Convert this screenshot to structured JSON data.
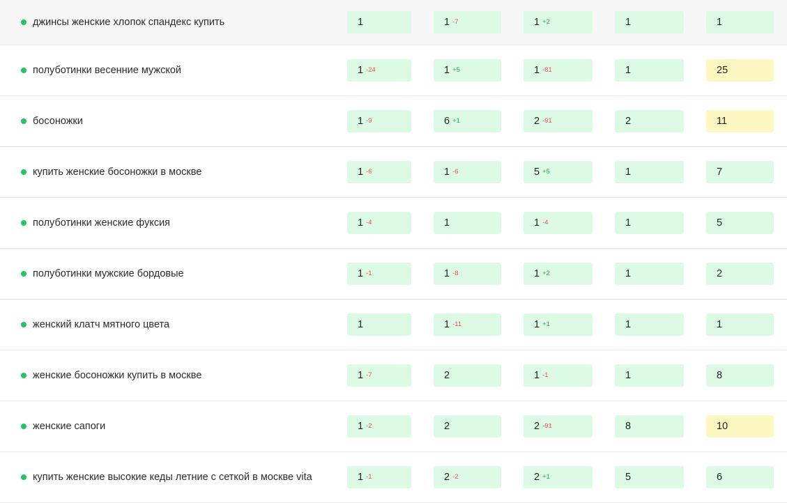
{
  "colors": {
    "good_cell": "#dcfae4",
    "warn_cell": "#fdf8c1",
    "delta_up": "#22a84a",
    "delta_down": "#ec4f4f",
    "status_dot": "#22c55e"
  },
  "rows": [
    {
      "keyword": "джинсы женские хлопок спандекс купить",
      "cells": [
        {
          "value": "1",
          "delta": "",
          "tone": "green"
        },
        {
          "value": "1",
          "delta": "-7",
          "tone": "green"
        },
        {
          "value": "1",
          "delta": "+2",
          "tone": "green"
        },
        {
          "value": "1",
          "delta": "",
          "tone": "green"
        },
        {
          "value": "1",
          "delta": "",
          "tone": "green"
        }
      ]
    },
    {
      "keyword": "полуботинки весенние мужской",
      "cells": [
        {
          "value": "1",
          "delta": "-24",
          "tone": "green"
        },
        {
          "value": "1",
          "delta": "+5",
          "tone": "green"
        },
        {
          "value": "1",
          "delta": "-81",
          "tone": "green"
        },
        {
          "value": "1",
          "delta": "",
          "tone": "green"
        },
        {
          "value": "25",
          "delta": "",
          "tone": "yellow"
        }
      ]
    },
    {
      "keyword": "босоножки",
      "cells": [
        {
          "value": "1",
          "delta": "-9",
          "tone": "green"
        },
        {
          "value": "6",
          "delta": "+1",
          "tone": "green"
        },
        {
          "value": "2",
          "delta": "-91",
          "tone": "green"
        },
        {
          "value": "2",
          "delta": "",
          "tone": "green"
        },
        {
          "value": "11",
          "delta": "",
          "tone": "yellow"
        }
      ]
    },
    {
      "keyword": "купить женские босоножки в москве",
      "cells": [
        {
          "value": "1",
          "delta": "-6",
          "tone": "green"
        },
        {
          "value": "1",
          "delta": "-6",
          "tone": "green"
        },
        {
          "value": "5",
          "delta": "+5",
          "tone": "green"
        },
        {
          "value": "1",
          "delta": "",
          "tone": "green"
        },
        {
          "value": "7",
          "delta": "",
          "tone": "green"
        }
      ]
    },
    {
      "keyword": "полуботинки женские фуксия",
      "cells": [
        {
          "value": "1",
          "delta": "-4",
          "tone": "green"
        },
        {
          "value": "1",
          "delta": "",
          "tone": "green"
        },
        {
          "value": "1",
          "delta": "-4",
          "tone": "green"
        },
        {
          "value": "1",
          "delta": "",
          "tone": "green"
        },
        {
          "value": "5",
          "delta": "",
          "tone": "green"
        }
      ]
    },
    {
      "keyword": "полуботинки мужские бордовые",
      "cells": [
        {
          "value": "1",
          "delta": "-1",
          "tone": "green"
        },
        {
          "value": "1",
          "delta": "-8",
          "tone": "green"
        },
        {
          "value": "1",
          "delta": "+2",
          "tone": "green"
        },
        {
          "value": "1",
          "delta": "",
          "tone": "green"
        },
        {
          "value": "2",
          "delta": "",
          "tone": "green"
        }
      ]
    },
    {
      "keyword": "женский клатч мятного цвета",
      "cells": [
        {
          "value": "1",
          "delta": "",
          "tone": "green"
        },
        {
          "value": "1",
          "delta": "-11",
          "tone": "green"
        },
        {
          "value": "1",
          "delta": "+1",
          "tone": "green"
        },
        {
          "value": "1",
          "delta": "",
          "tone": "green"
        },
        {
          "value": "1",
          "delta": "",
          "tone": "green"
        }
      ]
    },
    {
      "keyword": "женские босоножки купить в москве",
      "cells": [
        {
          "value": "1",
          "delta": "-7",
          "tone": "green"
        },
        {
          "value": "2",
          "delta": "",
          "tone": "green"
        },
        {
          "value": "1",
          "delta": "-1",
          "tone": "green"
        },
        {
          "value": "1",
          "delta": "",
          "tone": "green"
        },
        {
          "value": "8",
          "delta": "",
          "tone": "green"
        }
      ]
    },
    {
      "keyword": "женские сапоги",
      "cells": [
        {
          "value": "1",
          "delta": "-2",
          "tone": "green"
        },
        {
          "value": "2",
          "delta": "",
          "tone": "green"
        },
        {
          "value": "2",
          "delta": "-91",
          "tone": "green"
        },
        {
          "value": "8",
          "delta": "",
          "tone": "green"
        },
        {
          "value": "10",
          "delta": "",
          "tone": "yellow"
        }
      ]
    },
    {
      "keyword": "купить женские высокие кеды летние с сеткой в москве vita",
      "cells": [
        {
          "value": "1",
          "delta": "-1",
          "tone": "green"
        },
        {
          "value": "2",
          "delta": "-2",
          "tone": "green"
        },
        {
          "value": "2",
          "delta": "+1",
          "tone": "green"
        },
        {
          "value": "5",
          "delta": "",
          "tone": "green"
        },
        {
          "value": "6",
          "delta": "",
          "tone": "green"
        }
      ]
    }
  ]
}
